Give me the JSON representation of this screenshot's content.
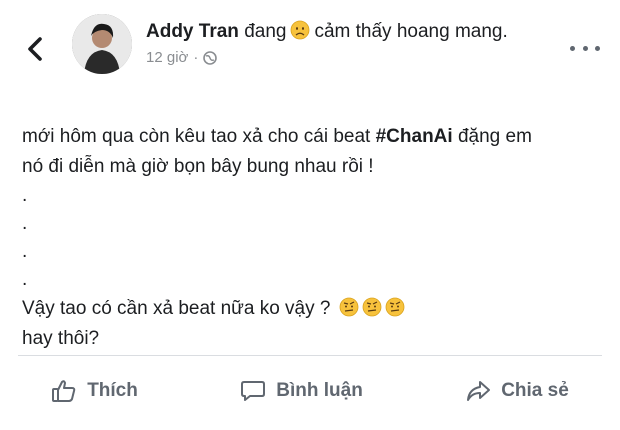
{
  "post": {
    "author": "Addy Tran",
    "feeling_prefix": "đang",
    "feeling_text": "cảm thấy hoang mang.",
    "time": "12 giờ",
    "separator": "·",
    "privacy_icon": "globe-icon",
    "body": {
      "line1_before": "mới hôm qua còn kêu tao xả cho cái beat ",
      "hashtag": "#ChanAi",
      "line1_after": " đặng em",
      "line2": "nó đi diễn mà giờ bọn bây bung nhau rồi !",
      "dots": [
        ".",
        ".",
        ".",
        "."
      ],
      "line3": "Vậy tao có cần xả beat nữa ko vậy ?",
      "line4": "hay thôi?"
    }
  },
  "actions": {
    "like": "Thích",
    "comment": "Bình luận",
    "share": "Chia sẻ"
  },
  "icons": {
    "back": "chevron-left-icon",
    "more": "more-horizontal-icon",
    "like": "thumbs-up-icon",
    "comment": "comment-bubble-icon",
    "share": "share-arrow-icon"
  },
  "colors": {
    "text": "#1c1e21",
    "muted": "#606770",
    "meta": "#8a8d91",
    "emoji": "#f7c23c"
  }
}
